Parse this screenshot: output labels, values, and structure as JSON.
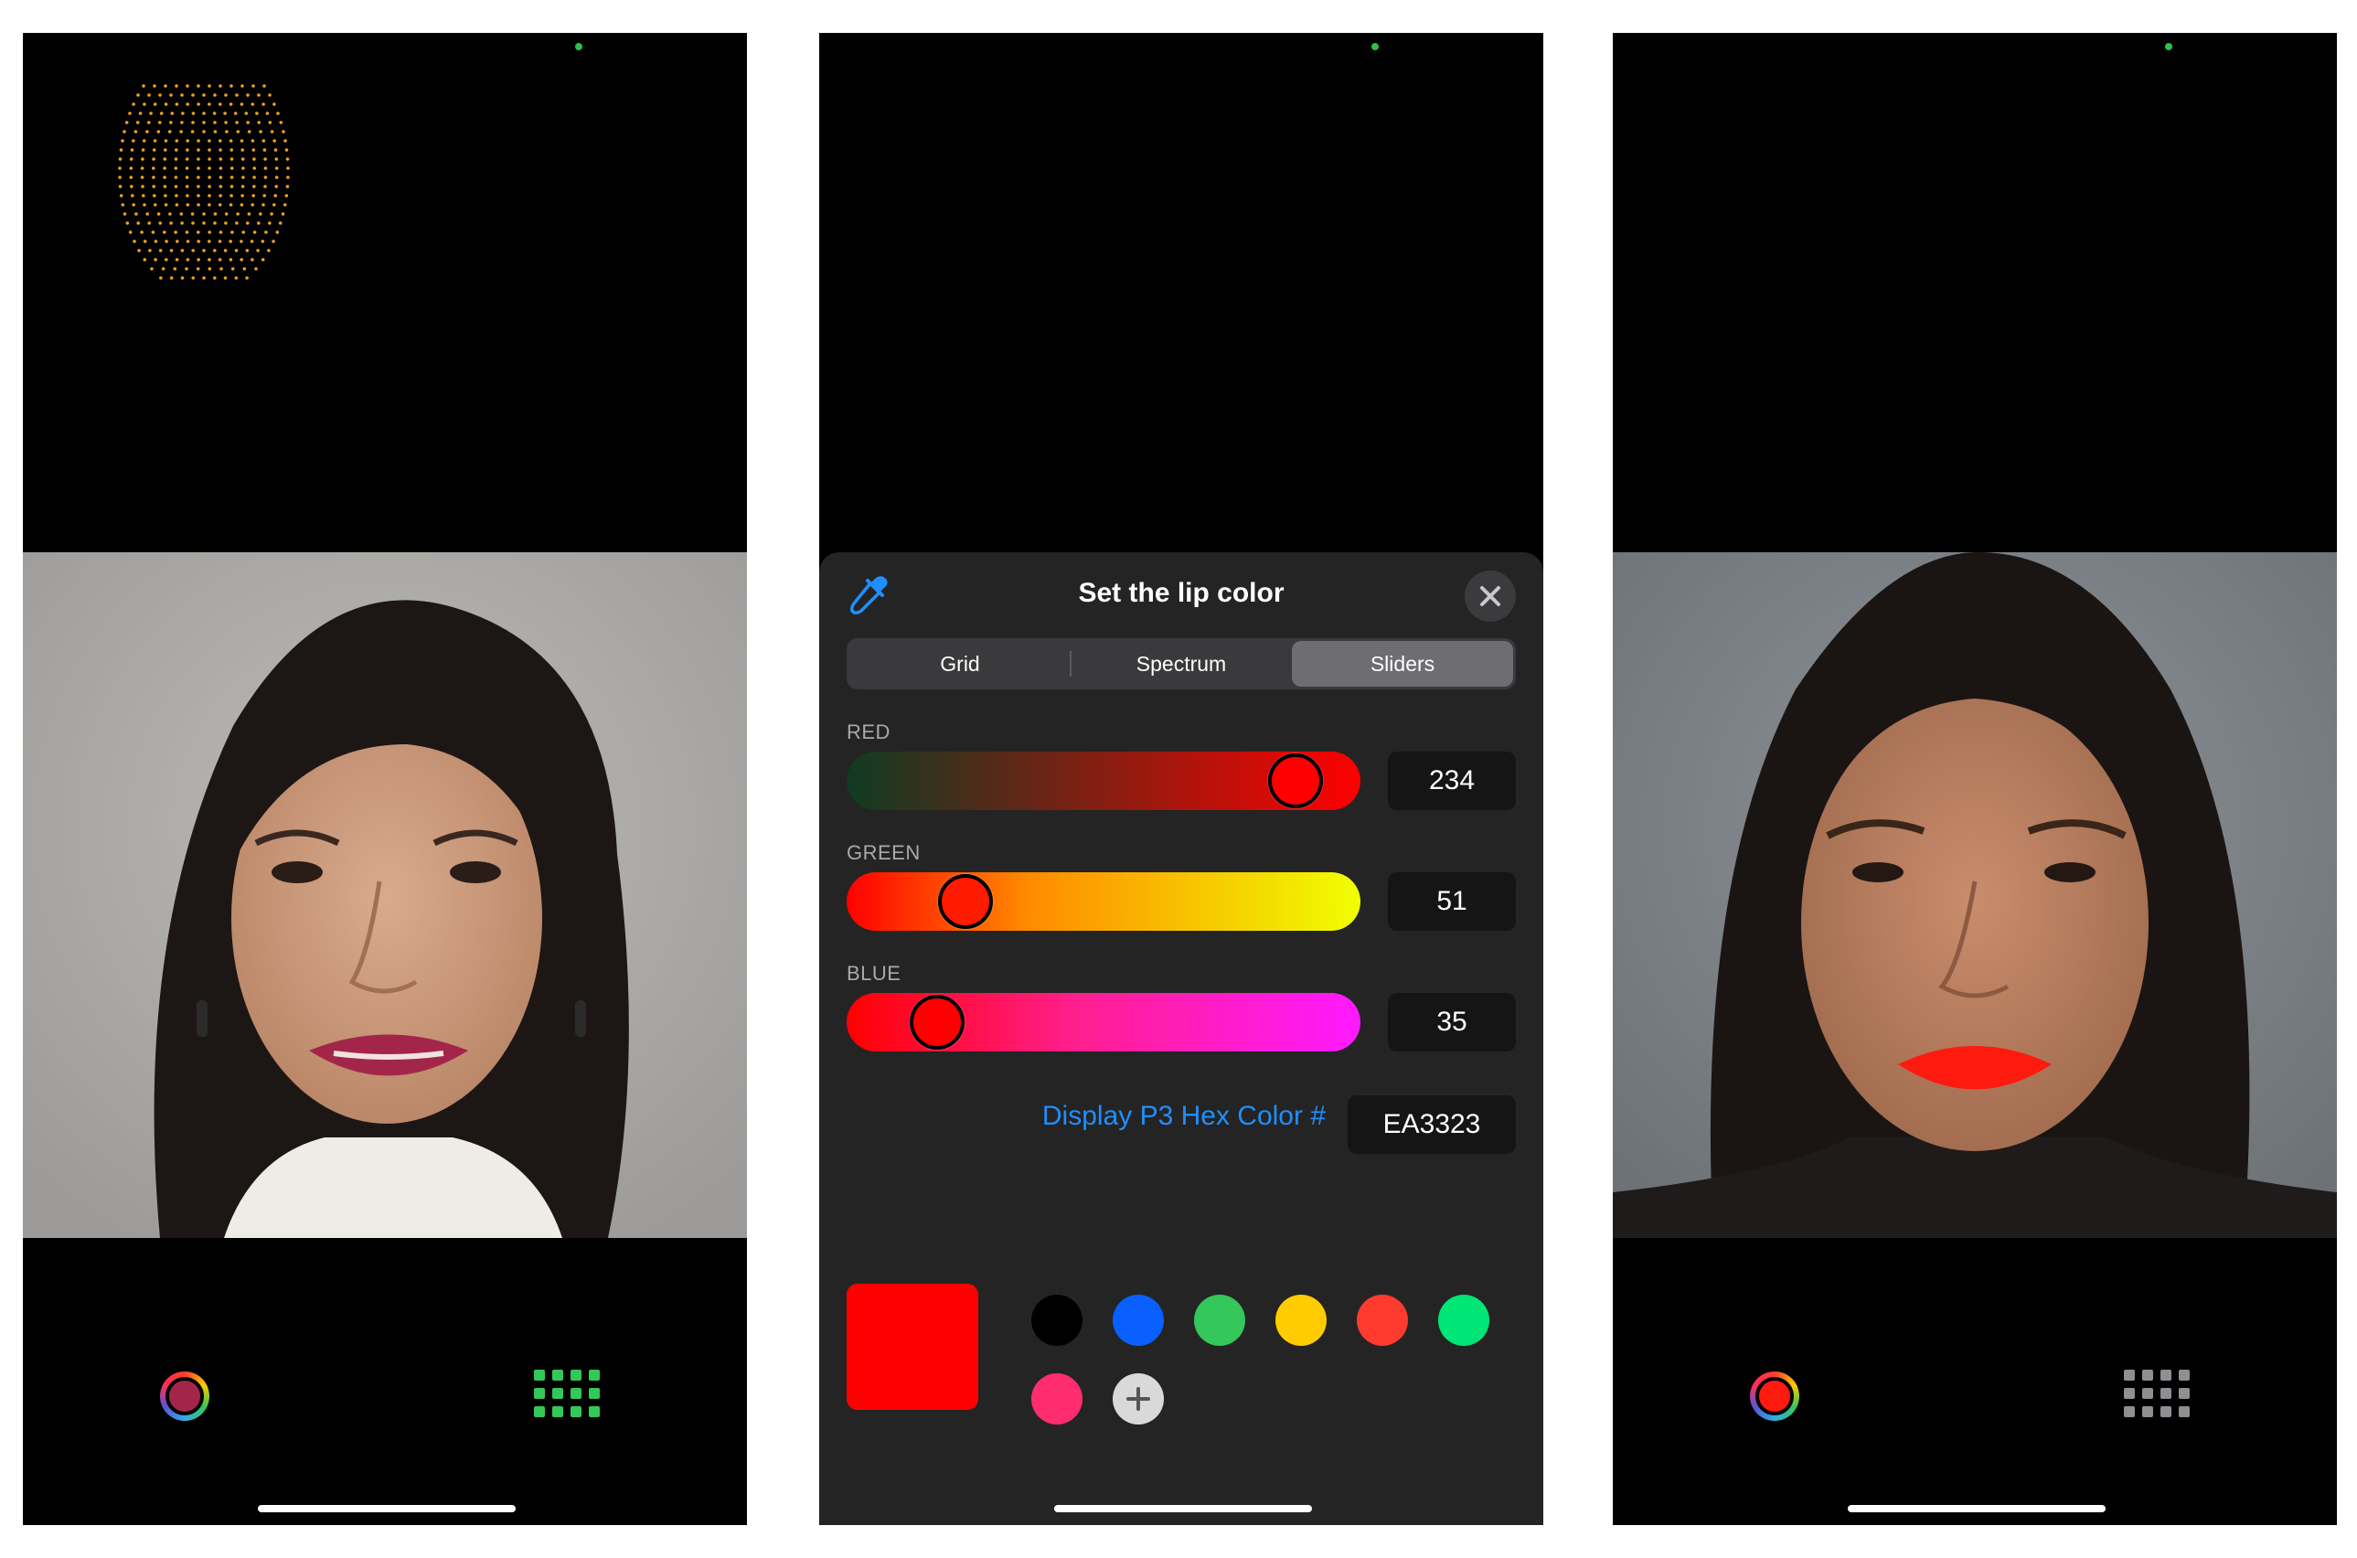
{
  "screens": {
    "left": {
      "selected_lip_color": "#a3264a",
      "grid_icon_color": "#34c759"
    },
    "middle": {
      "title": "Set the lip color",
      "tabs": [
        {
          "label": "Grid",
          "active": false
        },
        {
          "label": "Spectrum",
          "active": false
        },
        {
          "label": "Sliders",
          "active": true
        }
      ],
      "sliders": [
        {
          "label": "RED",
          "value": "234",
          "level": 0.918
        },
        {
          "label": "GREEN",
          "value": "51",
          "level": 0.2
        },
        {
          "label": "BLUE",
          "value": "35",
          "level": 0.137
        }
      ],
      "hex_label": "Display P3 Hex Color #",
      "hex_value": "EA3323",
      "current_color": "#ff0000",
      "swatches": [
        "#000000",
        "#0a60ff",
        "#34c759",
        "#ffcc00",
        "#ff3b30",
        "#00e676",
        "#ff2d6f"
      ],
      "accent": "#1f8fff"
    },
    "right": {
      "selected_lip_color": "#ff1a10",
      "grid_icon_color": "#8e8e93"
    }
  }
}
